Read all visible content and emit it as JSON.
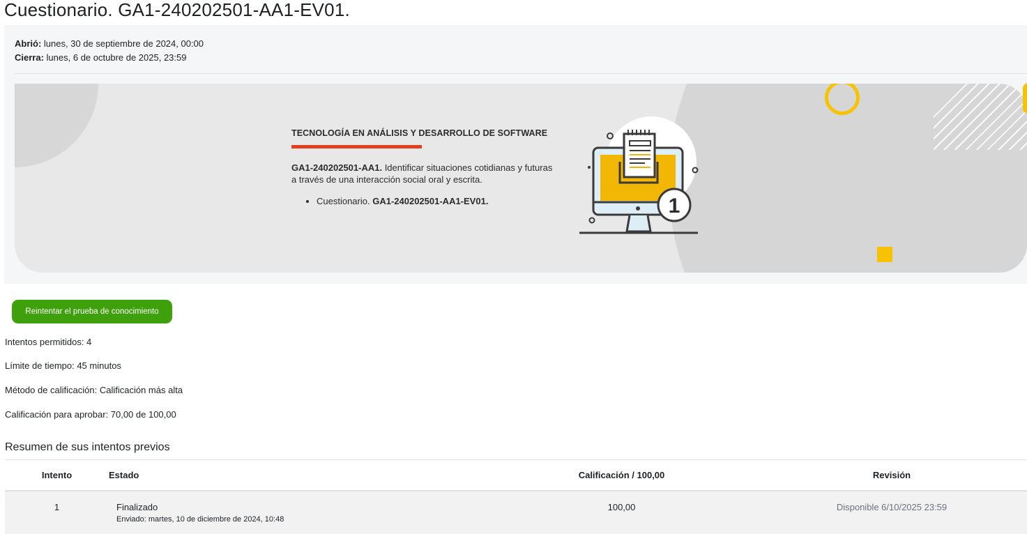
{
  "page": {
    "title": "Cuestionario. GA1-240202501-AA1-EV01."
  },
  "dates": {
    "opened_label": "Abrió:",
    "opened_value": "lunes, 30 de septiembre de 2024, 00:00",
    "closes_label": "Cierra:",
    "closes_value": "lunes, 6 de octubre de 2025, 23:59"
  },
  "banner": {
    "heading": "TECNOLOGÍA EN ANÁLISIS Y DESARROLLO DE SOFTWARE",
    "desc_code": "GA1-240202501-AA1.",
    "desc_text": " Identificar situaciones cotidianas y futuras a través de una interacción social oral y escrita.",
    "item_prefix": "Cuestionario. ",
    "item_code": "GA1-240202501-AA1-EV01.",
    "illustration_number": "1",
    "accent_color": "#f7c300",
    "underline_color": "#e0411f"
  },
  "actions": {
    "retry_label": "Reintentar el prueba de conocimiento",
    "button_color": "#3ea10b"
  },
  "quiz_info": {
    "attempts": "Intentos permitidos: 4",
    "time_limit": "Límite de tiempo: 45 minutos",
    "grading_method": "Método de calificación: Calificación más alta",
    "pass_grade": "Calificación para aprobar: 70,00 de 100,00"
  },
  "summary": {
    "title": "Resumen de sus intentos previos",
    "headers": [
      "Intento",
      "Estado",
      "Calificación / 100,00",
      "Revisión"
    ],
    "rows": [
      {
        "attempt": "1",
        "state": "Finalizado",
        "submitted": "Enviado: martes, 10 de diciembre de 2024, 10:48",
        "grade": "100,00",
        "review": "Disponible 6/10/2025 23:59"
      }
    ]
  }
}
